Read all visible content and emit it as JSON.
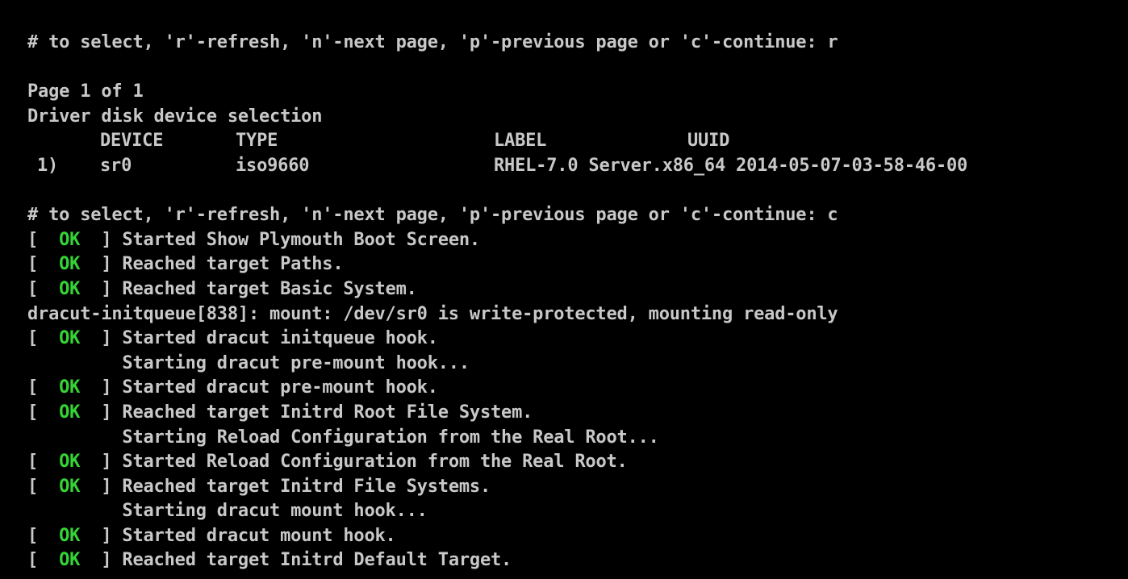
{
  "colors": {
    "background": "#000000",
    "text": "#c8c8c8",
    "ok": "#35d435"
  },
  "prompt1": "# to select, 'r'-refresh, 'n'-next page, 'p'-previous page or 'c'-continue: r",
  "page_info": "Page 1 of 1",
  "selection_title": "Driver disk device selection",
  "table": {
    "headers": [
      "DEVICE",
      "TYPE",
      "LABEL",
      "UUID"
    ],
    "rows": [
      {
        "num": "1)",
        "device": "sr0",
        "type": "iso9660",
        "label": "RHEL-7.0 Server.x86_64",
        "uuid": "2014-05-07-03-58-46-00"
      }
    ]
  },
  "prompt2": "# to select, 'r'-refresh, 'n'-next page, 'p'-previous page or 'c'-continue: c",
  "ok_label": "OK",
  "log": [
    {
      "status": "OK",
      "text": "Started Show Plymouth Boot Screen."
    },
    {
      "status": "OK",
      "text": "Reached target Paths."
    },
    {
      "status": "OK",
      "text": "Reached target Basic System."
    },
    {
      "status": "",
      "text": "dracut-initqueue[838]: mount: /dev/sr0 is write-protected, mounting read-only"
    },
    {
      "status": "OK",
      "text": "Started dracut initqueue hook."
    },
    {
      "status": "pending",
      "text": "Starting dracut pre-mount hook..."
    },
    {
      "status": "OK",
      "text": "Started dracut pre-mount hook."
    },
    {
      "status": "OK",
      "text": "Reached target Initrd Root File System."
    },
    {
      "status": "pending",
      "text": "Starting Reload Configuration from the Real Root..."
    },
    {
      "status": "OK",
      "text": "Started Reload Configuration from the Real Root."
    },
    {
      "status": "OK",
      "text": "Reached target Initrd File Systems."
    },
    {
      "status": "pending",
      "text": "Starting dracut mount hook..."
    },
    {
      "status": "OK",
      "text": "Started dracut mount hook."
    },
    {
      "status": "OK",
      "text": "Reached target Initrd Default Target."
    }
  ]
}
